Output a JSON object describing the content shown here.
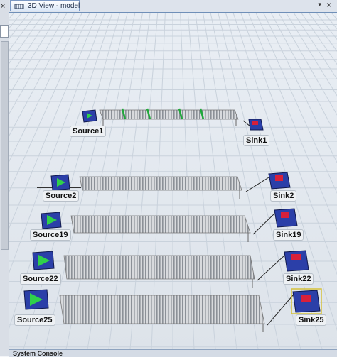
{
  "window": {
    "tab_title": "3D View - model",
    "pin_glyph": "▾",
    "close_glyph": "×"
  },
  "left_panel": {
    "close_glyph": "×"
  },
  "bottom_panel": {
    "title": "System Console"
  },
  "objects": {
    "source1": "Source1",
    "sink1": "Sink1",
    "source2": "Source2",
    "sink2": "Sink2",
    "source19": "Source19",
    "sink19": "Sink19",
    "source22": "Source22",
    "sink22": "Sink22",
    "source25": "Source25",
    "sink25": "Sink25"
  },
  "colors": {
    "source_body": "#2b3fa8",
    "source_arrow": "#2fd04a",
    "sink_flag": "#d8203a",
    "conveyor": "#9ea3aa",
    "floor_grid": "#c9d2dc"
  }
}
